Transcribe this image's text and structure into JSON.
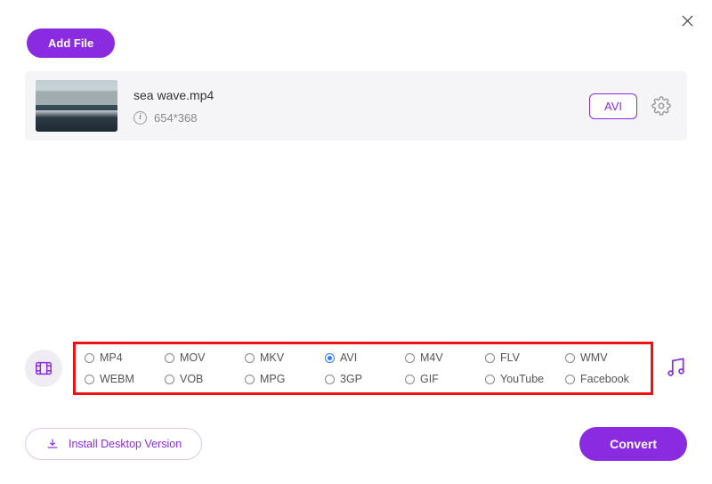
{
  "toolbar": {
    "add_file_label": "Add File"
  },
  "file": {
    "name": "sea wave.mp4",
    "dimensions": "654*368",
    "output_format": "AVI"
  },
  "formats": [
    {
      "id": "mp4",
      "label": "MP4",
      "selected": false
    },
    {
      "id": "mov",
      "label": "MOV",
      "selected": false
    },
    {
      "id": "mkv",
      "label": "MKV",
      "selected": false
    },
    {
      "id": "avi",
      "label": "AVI",
      "selected": true
    },
    {
      "id": "m4v",
      "label": "M4V",
      "selected": false
    },
    {
      "id": "flv",
      "label": "FLV",
      "selected": false
    },
    {
      "id": "wmv",
      "label": "WMV",
      "selected": false
    },
    {
      "id": "webm",
      "label": "WEBM",
      "selected": false
    },
    {
      "id": "vob",
      "label": "VOB",
      "selected": false
    },
    {
      "id": "mpg",
      "label": "MPG",
      "selected": false
    },
    {
      "id": "3gp",
      "label": "3GP",
      "selected": false
    },
    {
      "id": "gif",
      "label": "GIF",
      "selected": false
    },
    {
      "id": "yt",
      "label": "YouTube",
      "selected": false
    },
    {
      "id": "fb",
      "label": "Facebook",
      "selected": false
    }
  ],
  "footer": {
    "install_label": "Install Desktop Version",
    "convert_label": "Convert"
  },
  "colors": {
    "accent": "#8a2be2",
    "highlight_box": "#e11"
  }
}
